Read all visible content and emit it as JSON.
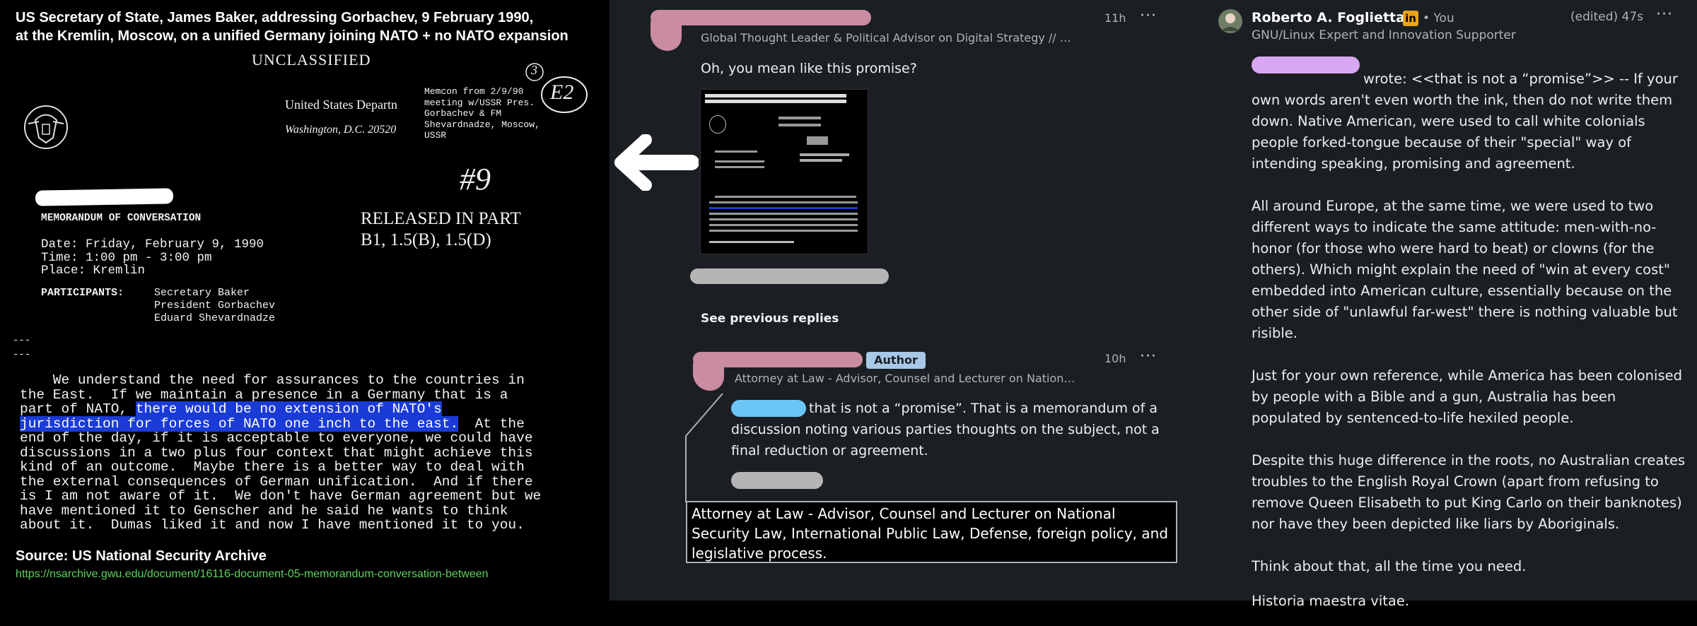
{
  "colors": {
    "comment_bg": "#1b1f23",
    "highlight": "#1a3bd6",
    "redact_pink": "#c98ca0",
    "redact_gray": "#b5b5b5",
    "redact_blue": "#6cc6f5",
    "redact_lilac": "#d8a7f2",
    "linkedin": "#e8a317",
    "author_badge": "#a8c8e8",
    "url_green": "#5fd25f"
  },
  "document": {
    "caption_line1": "US Secretary of State, James Baker, addressing Gorbachev, 9 February 1990,",
    "caption_line2": "at the Kremlin, Moscow, on a unified Germany joining NATO + no NATO expansion",
    "classification": "UNCLASSIFIED",
    "dept_line1": "United States Departn",
    "dept_line2": "Washington, D.C.  20520",
    "memcon": [
      "Memcon from 2/9/90",
      "meeting w/USSR Pres.",
      "Gorbachev & FM",
      "Shevardnadze, Moscow,",
      "USSR"
    ],
    "annot_3": "3",
    "annot_e2": "E2",
    "annot_9": "#9",
    "memo_title": "MEMORANDUM OF CONVERSATION",
    "released_line1": "RELEASED IN PART",
    "released_line2": "B1, 1.5(B), 1.5(D)",
    "date_line": "Date:  Friday, February 9, 1990",
    "time_line": "Time:  1:00 pm - 3:00 pm",
    "place_line": "Place: Kremlin",
    "participants_label": "PARTICIPANTS:",
    "participants": [
      "Secretary Baker",
      "President Gorbachev",
      "Eduard Shevardnadze"
    ],
    "divider": "---",
    "body_lines": [
      "    We understand the need for assurances to the countries in",
      "the East.  If we maintain a presence in a Germany that is a",
      "part of NATO, ",
      "there would be no extension of NATO's",
      "jurisdiction for forces of NATO one inch to the east.",
      "  At the",
      "end of the day, if it is acceptable to everyone, we could have",
      "discussions in a two plus four context that might achieve this",
      "kind of an outcome.  Maybe there is a better way to deal with",
      "the external consequences of German unification.  And if there",
      "is I am not aware of it.  We don't have German agreement but we",
      "have mentioned it to Genscher and he said he wants to think",
      "about it.  Dumas liked it and now I have mentioned it to you."
    ],
    "source": "Source: US National Security Archive",
    "url": "https://nsarchive.gwu.edu/document/16116-document-05-memorandum-conversation-between"
  },
  "comments": {
    "c1": {
      "headline": "Global Thought Leader & Political Advisor on Digital Strategy // …",
      "time": "11h",
      "menu": "···",
      "text": "Oh, you mean like this promise?"
    },
    "see_previous": "See previous replies",
    "c2": {
      "badge": "Author",
      "headline": "Attorney at Law - Advisor, Counsel and Lecturer on Nation…",
      "time": "10h",
      "menu": "···",
      "text": "that is not a “promise”. That is a memorandum of a discussion noting various parties thoughts on the subject, not a final reduction or agreement."
    },
    "tooltip": "Attorney at Law - Advisor, Counsel and Lecturer on National Security Law, International Public Law, Defense, foreign policy, and legislative process."
  },
  "long_comment": {
    "name": "Roberto A. Foglietta",
    "linkedin_icon": "in",
    "you": "• You",
    "edited": "(edited) 47s",
    "menu": "···",
    "headline": "GNU/Linux Expert and Innovation Supporter",
    "p1": " wrote: <<that is not a “promise”>> -- If your own words aren't even worth the ink, then do not write them down. Native American, were used to call white colonials people forked-tongue because of their \"special\" way of intending speaking, promising and agreement.",
    "p2": "All around Europe, at the same time, we were used to two different ways to indicate the same attitude: men-with-no-honor (for those who were hard to beat) or clowns (for the others). Which might explain the need of \"win at every cost\" embedded into American culture, essentially because on the other side of \"unlawful far-west\" there is nothing valuable but risible.",
    "p3": "Just for your own reference, while America has been colonised by people with a Bible and a gun, Australia has been populated by sentenced-to-life hexiled people.",
    "p4": "Despite this huge difference in the roots, no Australian creates troubles to the English Royal Crown (apart from refusing to remove Queen Elisabeth to put King Carlo on their banknotes) nor have they been depicted like liars by Aboriginals.",
    "p5a": "Think about that, all the time you need.",
    "p5b": "Historia maestra vitae."
  }
}
